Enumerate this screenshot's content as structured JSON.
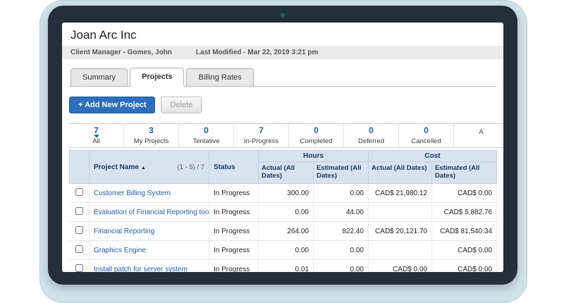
{
  "header": {
    "title": "Joan Arc Inc",
    "client_manager": "Client Manager - Gomes, John",
    "last_modified": "Last Modified - Mar 22, 2019 3:21 pm"
  },
  "tabs": [
    {
      "label": "Summary"
    },
    {
      "label": "Projects"
    },
    {
      "label": "Billing Rates"
    }
  ],
  "toolbar": {
    "add_label": "+ Add New Project",
    "delete_label": "Delete"
  },
  "filters": [
    {
      "count": "7",
      "label": "All"
    },
    {
      "count": "3",
      "label": "My Projects"
    },
    {
      "count": "0",
      "label": "Tentative"
    },
    {
      "count": "7",
      "label": "In-Progress"
    },
    {
      "count": "0",
      "label": "Completed"
    },
    {
      "count": "0",
      "label": "Deferred"
    },
    {
      "count": "0",
      "label": "Cancelled"
    },
    {
      "count": "",
      "label": "A"
    }
  ],
  "table": {
    "headers": {
      "project_name": "Project Name",
      "sort_indicator": "▲",
      "pagination": "(1 - 5) / 7",
      "status": "Status",
      "hours_group": "Hours",
      "cost_group": "Cost",
      "hours_actual": "Actual (All Dates)",
      "hours_estimated": "Estimated (All Dates)",
      "cost_actual": "Actual (All Dates)",
      "cost_estimated": "Estimated (All Dates)"
    },
    "rows": [
      {
        "name": "Customer Billing System",
        "status": "In Progress",
        "hours_actual": "300.00",
        "hours_estimated": "0.00",
        "cost_actual": "CAD$ 21,980.12",
        "cost_estimated": "CAD$ 0.00"
      },
      {
        "name": "Evaluation of Financial Reporting tools",
        "status": "In Progress",
        "hours_actual": "0.00",
        "hours_estimated": "44.00",
        "cost_actual": "",
        "cost_estimated": "CAD$ 5,882.76"
      },
      {
        "name": "Financial Reporting",
        "status": "In Progress",
        "hours_actual": "264.00",
        "hours_estimated": "822.40",
        "cost_actual": "CAD$ 20,121.70",
        "cost_estimated": "CAD$ 81,540.34"
      },
      {
        "name": "Graphics Engine",
        "status": "In Progress",
        "hours_actual": "0.00",
        "hours_estimated": "0.00",
        "cost_actual": "",
        "cost_estimated": "CAD$ 0.00"
      },
      {
        "name": "Install patch for server system",
        "status": "In Progress",
        "hours_actual": "0.01",
        "hours_estimated": "0.00",
        "cost_actual": "CAD$ 0.00",
        "cost_estimated": "CAD$ 0.00"
      },
      {
        "name": "",
        "status": "",
        "hours_actual": "",
        "hours_estimated": "",
        "cost_actual": "",
        "cost_estimated": ""
      }
    ]
  },
  "colors": {
    "accent_blue": "#2e6fbd",
    "link_blue": "#1f5fad",
    "table_header_bg": "#d8e3f0",
    "tablet_bezel": "#232f3b",
    "device_base": "#cfe2ea"
  }
}
